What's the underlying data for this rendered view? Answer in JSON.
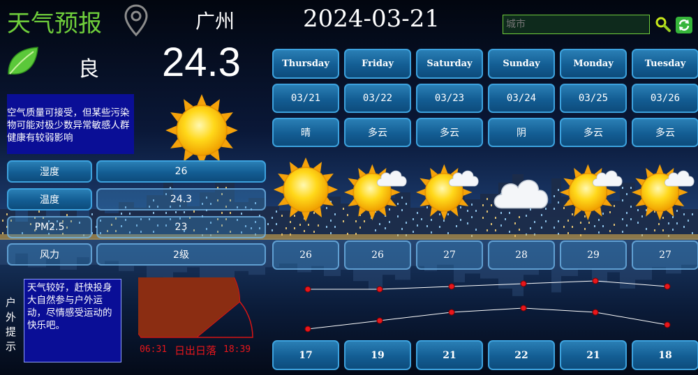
{
  "header": {
    "app_title": "天气预报",
    "city_name": "广州",
    "date": "2024-03-21",
    "search_placeholder": "城市",
    "search_icon": "magnifier-icon",
    "refresh_icon": "refresh-icon"
  },
  "current": {
    "air_quality": "良",
    "temperature": "24.3",
    "air_quality_note": "空气质量可接受，但某些污染物可能对极少数异常敏感人群健康有较弱影响",
    "weather_icon": "sunny-icon",
    "stats": [
      {
        "label": "湿度",
        "value": "26"
      },
      {
        "label": "温度",
        "value": "24.3"
      },
      {
        "label": "PM2.5",
        "value": "23"
      },
      {
        "label": "风力",
        "value": "2级"
      }
    ],
    "outdoor_label": "户外提示",
    "outdoor_tip": "天气较好，赶快投身大自然参与户外运动，尽情感受运动的快乐吧。",
    "sunrise": "06:31",
    "sun_label": "日出日落",
    "sunset": "18:39",
    "sun_progress": 0.78
  },
  "forecast": [
    {
      "day": "Thursday",
      "date": "03/21",
      "weather": "晴",
      "icon": "sunny-icon",
      "high": 26,
      "low": 17
    },
    {
      "day": "Friday",
      "date": "03/22",
      "weather": "多云",
      "icon": "partly-cloudy-icon",
      "high": 26,
      "low": 19
    },
    {
      "day": "Saturday",
      "date": "03/23",
      "weather": "多云",
      "icon": "partly-cloudy-icon",
      "high": 27,
      "low": 21
    },
    {
      "day": "Sunday",
      "date": "03/24",
      "weather": "阴",
      "icon": "cloudy-icon",
      "high": 28,
      "low": 22
    },
    {
      "day": "Monday",
      "date": "03/25",
      "weather": "多云",
      "icon": "partly-cloudy-icon",
      "high": 29,
      "low": 21
    },
    {
      "day": "Tuesday",
      "date": "03/26",
      "weather": "多云",
      "icon": "partly-cloudy-icon",
      "high": 27,
      "low": 18
    }
  ],
  "colors": {
    "accent_green": "#6fce3b",
    "pill_blue": "#1a6aa3",
    "note_bg": "#0a0e96",
    "curve_point": "#e8161b"
  }
}
